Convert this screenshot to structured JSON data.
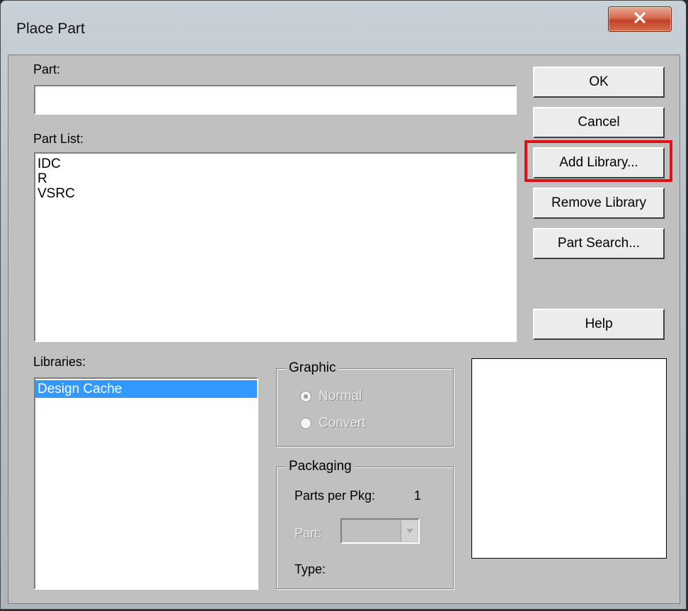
{
  "window": {
    "title": "Place Part"
  },
  "part": {
    "label": "Part:",
    "value": ""
  },
  "part_list": {
    "label": "Part List:",
    "items": [
      "IDC",
      "R",
      "VSRC"
    ]
  },
  "libraries": {
    "label": "Libraries:",
    "items": [
      "Design Cache"
    ],
    "selected": "Design Cache"
  },
  "buttons": {
    "ok": "OK",
    "cancel": "Cancel",
    "add_library": "Add Library...",
    "remove_library": "Remove Library",
    "part_search": "Part Search...",
    "help": "Help"
  },
  "graphic": {
    "title": "Graphic",
    "normal": "Normal",
    "convert": "Convert"
  },
  "packaging": {
    "title": "Packaging",
    "parts_per_pkg_label": "Parts per Pkg:",
    "parts_per_pkg_value": "1",
    "part_label": "Part:",
    "type_label": "Type:"
  },
  "colors": {
    "highlight": "#e0101a",
    "selection": "#3399ff",
    "close_button": "#c2432a"
  },
  "icons": {
    "close": "close-icon",
    "dropdown": "chevron-down-icon"
  }
}
